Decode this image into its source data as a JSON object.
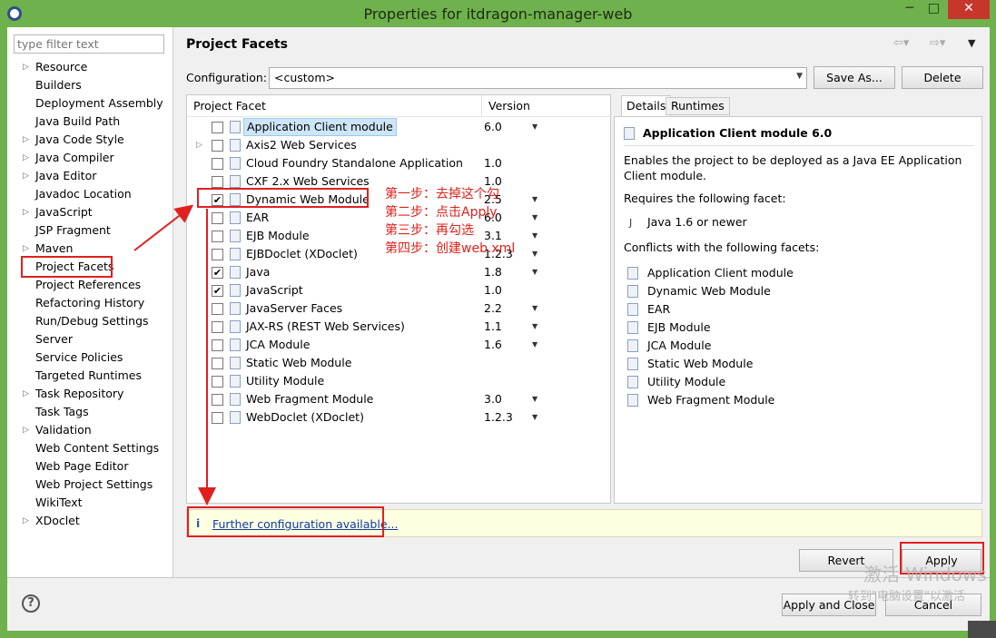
{
  "window": {
    "title": "Properties for itdragon-manager-web",
    "minimize": "─",
    "maximize": "□",
    "close": "✕"
  },
  "sidebar": {
    "filter_placeholder": "type filter text",
    "items": [
      {
        "label": "Resource",
        "expandable": true
      },
      {
        "label": "Builders",
        "expandable": false
      },
      {
        "label": "Deployment Assembly",
        "expandable": false
      },
      {
        "label": "Java Build Path",
        "expandable": false
      },
      {
        "label": "Java Code Style",
        "expandable": true
      },
      {
        "label": "Java Compiler",
        "expandable": true
      },
      {
        "label": "Java Editor",
        "expandable": true
      },
      {
        "label": "Javadoc Location",
        "expandable": false
      },
      {
        "label": "JavaScript",
        "expandable": true
      },
      {
        "label": "JSP Fragment",
        "expandable": false
      },
      {
        "label": "Maven",
        "expandable": true
      },
      {
        "label": "Project Facets",
        "expandable": false
      },
      {
        "label": "Project References",
        "expandable": false
      },
      {
        "label": "Refactoring History",
        "expandable": false
      },
      {
        "label": "Run/Debug Settings",
        "expandable": false
      },
      {
        "label": "Server",
        "expandable": false
      },
      {
        "label": "Service Policies",
        "expandable": false
      },
      {
        "label": "Targeted Runtimes",
        "expandable": false
      },
      {
        "label": "Task Repository",
        "expandable": true
      },
      {
        "label": "Task Tags",
        "expandable": false
      },
      {
        "label": "Validation",
        "expandable": true
      },
      {
        "label": "Web Content Settings",
        "expandable": false
      },
      {
        "label": "Web Page Editor",
        "expandable": false
      },
      {
        "label": "Web Project Settings",
        "expandable": false
      },
      {
        "label": "WikiText",
        "expandable": false
      },
      {
        "label": "XDoclet",
        "expandable": true
      }
    ]
  },
  "page": {
    "title": "Project Facets",
    "config_label": "Configuration:",
    "config_value": "<custom>",
    "save_as": "Save As...",
    "delete": "Delete"
  },
  "facets": {
    "col_facet": "Project Facet",
    "col_version": "Version",
    "rows": [
      {
        "name": "Application Client module",
        "version": "6.0",
        "checked": false,
        "dropdown": true,
        "expandable": false,
        "selected": true
      },
      {
        "name": "Axis2 Web Services",
        "version": "",
        "checked": false,
        "dropdown": false,
        "expandable": true,
        "selected": false
      },
      {
        "name": "Cloud Foundry Standalone Application",
        "version": "1.0",
        "checked": false,
        "dropdown": false,
        "expandable": false,
        "selected": false
      },
      {
        "name": "CXF 2.x Web Services",
        "version": "1.0",
        "checked": false,
        "dropdown": false,
        "expandable": false,
        "selected": false
      },
      {
        "name": "Dynamic Web Module",
        "version": "2.5",
        "checked": true,
        "dropdown": true,
        "expandable": false,
        "selected": false
      },
      {
        "name": "EAR",
        "version": "6.0",
        "checked": false,
        "dropdown": true,
        "expandable": false,
        "selected": false
      },
      {
        "name": "EJB Module",
        "version": "3.1",
        "checked": false,
        "dropdown": true,
        "expandable": false,
        "selected": false
      },
      {
        "name": "EJBDoclet (XDoclet)",
        "version": "1.2.3",
        "checked": false,
        "dropdown": true,
        "expandable": false,
        "selected": false
      },
      {
        "name": "Java",
        "version": "1.8",
        "checked": true,
        "dropdown": true,
        "expandable": false,
        "selected": false
      },
      {
        "name": "JavaScript",
        "version": "1.0",
        "checked": true,
        "dropdown": false,
        "expandable": false,
        "selected": false
      },
      {
        "name": "JavaServer Faces",
        "version": "2.2",
        "checked": false,
        "dropdown": true,
        "expandable": false,
        "selected": false
      },
      {
        "name": "JAX-RS (REST Web Services)",
        "version": "1.1",
        "checked": false,
        "dropdown": true,
        "expandable": false,
        "selected": false
      },
      {
        "name": "JCA Module",
        "version": "1.6",
        "checked": false,
        "dropdown": true,
        "expandable": false,
        "selected": false
      },
      {
        "name": "Static Web Module",
        "version": "",
        "checked": false,
        "dropdown": false,
        "expandable": false,
        "selected": false
      },
      {
        "name": "Utility Module",
        "version": "",
        "checked": false,
        "dropdown": false,
        "expandable": false,
        "selected": false
      },
      {
        "name": "Web Fragment Module",
        "version": "3.0",
        "checked": false,
        "dropdown": true,
        "expandable": false,
        "selected": false
      },
      {
        "name": "WebDoclet (XDoclet)",
        "version": "1.2.3",
        "checked": false,
        "dropdown": true,
        "expandable": false,
        "selected": false
      }
    ]
  },
  "annotations": {
    "step1": "第一步：去掉这个勾",
    "step2": "第二步：点击Apply",
    "step3": "第三步：再勾选",
    "step4": "第四步：创建web.xml"
  },
  "details": {
    "tab_details": "Details",
    "tab_runtimes": "Runtimes",
    "heading": "Application Client module 6.0",
    "description": "Enables the project to be deployed as a Java EE Application Client module.",
    "requires_label": "Requires the following facet:",
    "requires_item": "Java 1.6 or newer",
    "conflicts_label": "Conflicts with the following facets:",
    "conflicts": [
      "Application Client module",
      "Dynamic Web Module",
      "EAR",
      "EJB Module",
      "JCA Module",
      "Static Web Module",
      "Utility Module",
      "Web Fragment Module"
    ]
  },
  "further": {
    "link": "Further configuration available..."
  },
  "buttons": {
    "revert": "Revert",
    "apply": "Apply",
    "ok": "Apply and Close",
    "cancel": "Cancel"
  },
  "watermark": {
    "line1": "激活 Windows",
    "line2": "转到\"电脑设置\"以激活"
  },
  "colors": {
    "titlebar": "#6fb24d",
    "highlight": "#e02020",
    "selection": "#cde6f7"
  }
}
